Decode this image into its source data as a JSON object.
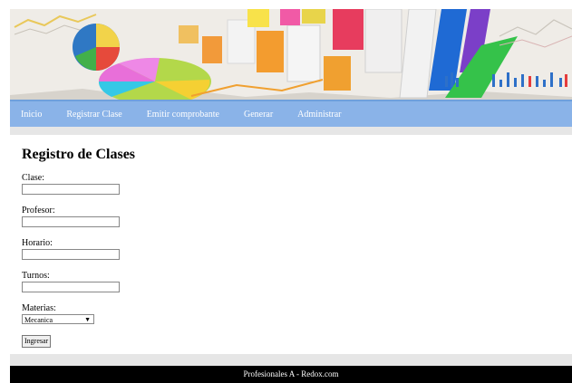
{
  "nav": {
    "items": [
      "Inicio",
      "Registrar Clase",
      "Emitir comprobante",
      "Generar",
      "Administrar"
    ]
  },
  "page": {
    "title": "Registro de Clases"
  },
  "form": {
    "clase_label": "Clase:",
    "clase_value": "",
    "profesor_label": "Profesor:",
    "profesor_value": "",
    "horario_label": "Horario:",
    "horario_value": "",
    "turnos_label": "Turnos:",
    "turnos_value": "",
    "materias_label": "Materias:",
    "materias_selected": "Mecanica",
    "submit_label": "Ingresar"
  },
  "footer": {
    "text": "Profesionales A - Redox.com"
  },
  "colors": {
    "nav_bg": "#8ab3e8",
    "footer_bg": "#000000",
    "strip_bg": "#e6e6e6"
  }
}
